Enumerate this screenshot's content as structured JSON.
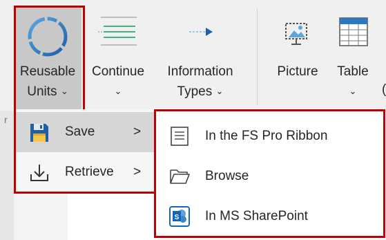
{
  "ribbon": {
    "buttons": [
      {
        "id": "reusable-units",
        "line1": "Reusable",
        "line2": "Units",
        "icon": "circle-ring-icon"
      },
      {
        "id": "continue",
        "line1": "Continue",
        "line2": "",
        "icon": "continue-lines-icon"
      },
      {
        "id": "information-types",
        "line1": "Information",
        "line2": "Types",
        "icon": "arrow-right-icon"
      },
      {
        "id": "picture",
        "line1": "Picture",
        "line2": "",
        "icon": "picture-icon"
      },
      {
        "id": "table",
        "line1": "Table",
        "line2": "",
        "icon": "table-icon"
      }
    ],
    "chevron_glyph": "⌄",
    "cut_char": "(",
    "stray_char": "r"
  },
  "reusable_menu": {
    "items": [
      {
        "label": "Save",
        "icon": "floppy-disk-icon",
        "arrow": ">"
      },
      {
        "label": "Retrieve",
        "icon": "download-icon",
        "arrow": ">"
      }
    ]
  },
  "save_submenu": {
    "items": [
      {
        "label": "In the FS Pro Ribbon",
        "icon": "document-icon"
      },
      {
        "label": "Browse",
        "icon": "folder-icon"
      },
      {
        "label": "In MS SharePoint",
        "icon": "sharepoint-icon"
      }
    ]
  },
  "colors": {
    "highlight_border": "#c00000",
    "ring_blue": "#2b79c2",
    "sharepoint_blue": "#1565c0"
  }
}
